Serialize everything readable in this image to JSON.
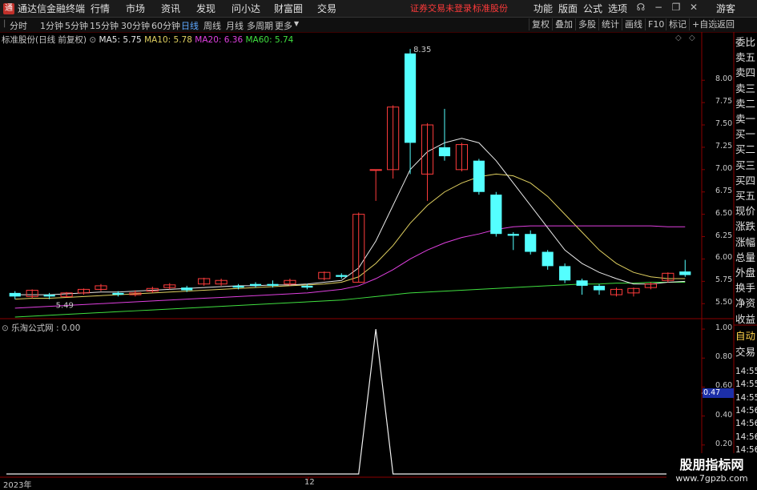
{
  "titlebar": {
    "app_name": "通达信金融终端",
    "menus": [
      "行情",
      "市场",
      "资讯",
      "发现",
      "问小达",
      "财富圈",
      "交易"
    ],
    "alert": "证券交易未登录",
    "alert_stock": "标准股份",
    "right_menus": [
      "功能",
      "版面",
      "公式",
      "选项"
    ],
    "guest": "游客"
  },
  "toolbar": {
    "periods": [
      "分时",
      "1分钟",
      "5分钟",
      "15分钟",
      "30分钟",
      "60分钟",
      "日线",
      "周线",
      "月线",
      "多周期",
      "更多"
    ],
    "active_period": "日线",
    "right_buttons": [
      "复权",
      "叠加",
      "多股",
      "统计",
      "画线",
      "F10",
      "标记",
      "+自选",
      "返回"
    ]
  },
  "main_chart": {
    "stock_label": "标准股份(日线 前复权)",
    "ma": [
      {
        "label": "MA5: 5.75",
        "color": "#e8e8e8"
      },
      {
        "label": "MA10: 5.78",
        "color": "#e0d060"
      },
      {
        "label": "MA20: 6.36",
        "color": "#e040e0"
      },
      {
        "label": "MA60: 5.74",
        "color": "#40e040"
      }
    ],
    "y_ticks": [
      "8.00",
      "7.75",
      "7.50",
      "7.25",
      "7.00",
      "6.75",
      "6.50",
      "6.25",
      "6.00",
      "5.75",
      "5.50"
    ],
    "high_label": "8.35",
    "low_label": "5.49"
  },
  "sub_chart": {
    "label": "乐淘公式网 : 0.00",
    "y_ticks": [
      "1.00",
      "0.80",
      "0.60",
      "0.40",
      "0.20"
    ],
    "cursor_value": "0.47"
  },
  "x_axis": {
    "labels": [
      "2023年",
      "12"
    ]
  },
  "right_panel": {
    "labels": [
      "委比",
      "卖五",
      "卖四",
      "卖三",
      "卖二",
      "卖一",
      "买一",
      "买二",
      "买三",
      "买四",
      "买五",
      "现价",
      "涨跌",
      "涨幅",
      "总量",
      "外盘",
      "换手",
      "净资",
      "收益",
      "自动",
      "交易",
      "14:55",
      "14:55",
      "14:55",
      "14:56",
      "14:56",
      "14:56",
      "14:56",
      "14:56",
      "14:56"
    ]
  },
  "watermark": {
    "line1": "股朋指标网",
    "line2": "www.7gpzb.com"
  },
  "chart_data": {
    "type": "candlestick",
    "candles": [
      {
        "o": 5.62,
        "c": 5.58,
        "h": 5.64,
        "l": 5.55
      },
      {
        "o": 5.58,
        "c": 5.65,
        "h": 5.66,
        "l": 5.56
      },
      {
        "o": 5.6,
        "c": 5.58,
        "h": 5.62,
        "l": 5.55
      },
      {
        "o": 5.58,
        "c": 5.62,
        "h": 5.63,
        "l": 5.57
      },
      {
        "o": 5.62,
        "c": 5.66,
        "h": 5.67,
        "l": 5.6
      },
      {
        "o": 5.66,
        "c": 5.7,
        "h": 5.72,
        "l": 5.64
      },
      {
        "o": 5.62,
        "c": 5.6,
        "h": 5.64,
        "l": 5.58
      },
      {
        "o": 5.6,
        "c": 5.62,
        "h": 5.65,
        "l": 5.58
      },
      {
        "o": 5.64,
        "c": 5.67,
        "h": 5.69,
        "l": 5.62
      },
      {
        "o": 5.68,
        "c": 5.71,
        "h": 5.73,
        "l": 5.66
      },
      {
        "o": 5.68,
        "c": 5.65,
        "h": 5.7,
        "l": 5.63
      },
      {
        "o": 5.72,
        "c": 5.78,
        "h": 5.79,
        "l": 5.7
      },
      {
        "o": 5.72,
        "c": 5.76,
        "h": 5.78,
        "l": 5.7
      },
      {
        "o": 5.7,
        "c": 5.68,
        "h": 5.72,
        "l": 5.66
      },
      {
        "o": 5.72,
        "c": 5.7,
        "h": 5.74,
        "l": 5.68
      },
      {
        "o": 5.72,
        "c": 5.7,
        "h": 5.76,
        "l": 5.68
      },
      {
        "o": 5.72,
        "c": 5.76,
        "h": 5.78,
        "l": 5.7
      },
      {
        "o": 5.7,
        "c": 5.68,
        "h": 5.72,
        "l": 5.66
      },
      {
        "o": 5.78,
        "c": 5.85,
        "h": 5.86,
        "l": 5.76
      },
      {
        "o": 5.82,
        "c": 5.8,
        "h": 5.84,
        "l": 5.78
      },
      {
        "o": 5.74,
        "c": 6.5,
        "h": 6.52,
        "l": 5.74
      },
      {
        "o": 7.0,
        "c": 7.0,
        "h": 7.0,
        "l": 6.65
      },
      {
        "o": 7.0,
        "c": 7.7,
        "h": 7.72,
        "l": 6.9
      },
      {
        "o": 8.3,
        "c": 7.3,
        "h": 8.35,
        "l": 6.95
      },
      {
        "o": 6.95,
        "c": 7.5,
        "h": 7.52,
        "l": 6.65
      },
      {
        "o": 7.25,
        "c": 7.15,
        "h": 7.68,
        "l": 7.1
      },
      {
        "o": 7.0,
        "c": 7.28,
        "h": 7.3,
        "l": 6.98
      },
      {
        "o": 7.1,
        "c": 6.75,
        "h": 7.12,
        "l": 6.72
      },
      {
        "o": 6.72,
        "c": 6.28,
        "h": 6.75,
        "l": 6.25
      },
      {
        "o": 6.28,
        "c": 6.26,
        "h": 6.3,
        "l": 6.1
      },
      {
        "o": 6.28,
        "c": 6.08,
        "h": 6.32,
        "l": 6.05
      },
      {
        "o": 6.08,
        "c": 5.92,
        "h": 6.1,
        "l": 5.88
      },
      {
        "o": 5.92,
        "c": 5.76,
        "h": 5.95,
        "l": 5.73
      },
      {
        "o": 5.76,
        "c": 5.7,
        "h": 5.78,
        "l": 5.6
      },
      {
        "o": 5.7,
        "c": 5.65,
        "h": 5.72,
        "l": 5.6
      },
      {
        "o": 5.6,
        "c": 5.66,
        "h": 5.68,
        "l": 5.58
      },
      {
        "o": 5.62,
        "c": 5.67,
        "h": 5.68,
        "l": 5.58
      },
      {
        "o": 5.68,
        "c": 5.72,
        "h": 5.74,
        "l": 5.66
      },
      {
        "o": 5.76,
        "c": 5.84,
        "h": 5.85,
        "l": 5.74
      },
      {
        "o": 5.86,
        "c": 5.82,
        "h": 5.99,
        "l": 5.8
      }
    ],
    "ma5": [
      5.6,
      5.6,
      5.6,
      5.61,
      5.62,
      5.63,
      5.63,
      5.64,
      5.65,
      5.66,
      5.67,
      5.68,
      5.69,
      5.7,
      5.7,
      5.71,
      5.71,
      5.72,
      5.74,
      5.76,
      5.9,
      6.2,
      6.6,
      7.0,
      7.2,
      7.3,
      7.35,
      7.3,
      7.1,
      6.85,
      6.6,
      6.35,
      6.1,
      5.95,
      5.85,
      5.78,
      5.72,
      5.72,
      5.74,
      5.75
    ],
    "ma10": [
      5.55,
      5.56,
      5.56,
      5.57,
      5.58,
      5.59,
      5.6,
      5.61,
      5.62,
      5.63,
      5.64,
      5.65,
      5.66,
      5.67,
      5.68,
      5.69,
      5.7,
      5.71,
      5.72,
      5.74,
      5.8,
      5.95,
      6.15,
      6.4,
      6.6,
      6.75,
      6.85,
      6.92,
      6.95,
      6.93,
      6.85,
      6.7,
      6.5,
      6.3,
      6.1,
      5.95,
      5.85,
      5.8,
      5.78,
      5.78
    ],
    "ma20": [
      5.45,
      5.46,
      5.47,
      5.48,
      5.49,
      5.5,
      5.51,
      5.52,
      5.53,
      5.54,
      5.55,
      5.56,
      5.57,
      5.58,
      5.59,
      5.6,
      5.61,
      5.62,
      5.64,
      5.66,
      5.7,
      5.78,
      5.88,
      6.0,
      6.1,
      6.18,
      6.24,
      6.28,
      6.33,
      6.36,
      6.37,
      6.37,
      6.37,
      6.37,
      6.37,
      6.37,
      6.37,
      6.37,
      6.36,
      6.36
    ],
    "ma60": [
      5.35,
      5.36,
      5.37,
      5.38,
      5.39,
      5.4,
      5.41,
      5.42,
      5.43,
      5.44,
      5.45,
      5.46,
      5.47,
      5.48,
      5.49,
      5.5,
      5.51,
      5.52,
      5.53,
      5.54,
      5.56,
      5.58,
      5.6,
      5.62,
      5.63,
      5.64,
      5.65,
      5.66,
      5.67,
      5.68,
      5.69,
      5.7,
      5.71,
      5.72,
      5.72,
      5.73,
      5.73,
      5.74,
      5.74,
      5.74
    ],
    "indicator": [
      0,
      0,
      0,
      0,
      0,
      0,
      0,
      0,
      0,
      0,
      0,
      0,
      0,
      0,
      0,
      0,
      0,
      0,
      0,
      0,
      0,
      1,
      0,
      0,
      0,
      0,
      0,
      0,
      0,
      0,
      0,
      0,
      0,
      0,
      0,
      0,
      0,
      0,
      0,
      0
    ],
    "y_range": [
      5.35,
      8.45
    ],
    "indicator_range": [
      0,
      1.05
    ]
  }
}
